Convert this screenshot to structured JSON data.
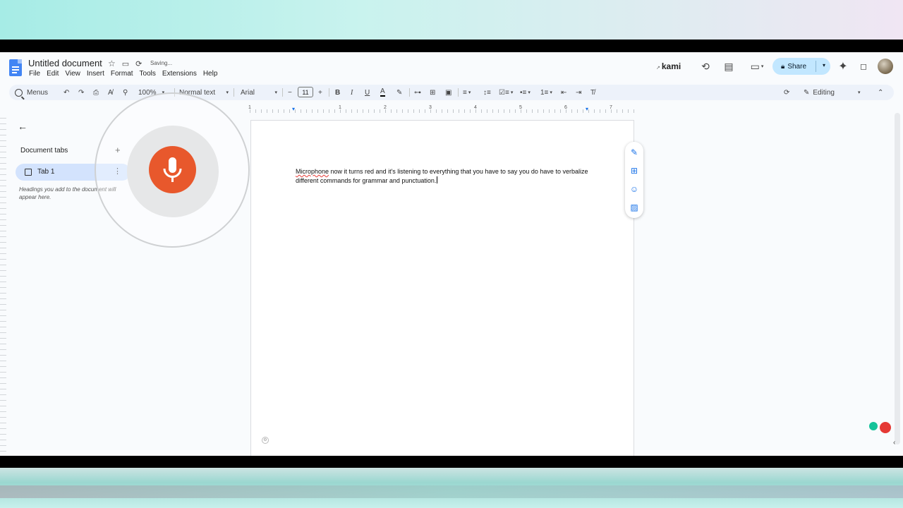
{
  "document": {
    "title": "Untitled document",
    "status": "Saving..."
  },
  "menu": [
    "File",
    "Edit",
    "View",
    "Insert",
    "Format",
    "Tools",
    "Extensions",
    "Help"
  ],
  "header_right": {
    "kami_label": "kami",
    "share_label": "Share"
  },
  "toolbar": {
    "search_label": "Menus",
    "zoom": "100%",
    "style": "Normal text",
    "font": "Arial",
    "font_size": "11",
    "mode": "Editing"
  },
  "sidebar": {
    "title": "Document tabs",
    "tabs": [
      {
        "label": "Tab 1"
      }
    ],
    "hint": "Headings you add to the document will appear here."
  },
  "ruler": {
    "marks": [
      "1",
      "1",
      "2",
      "3",
      "4",
      "5",
      "6",
      "7"
    ]
  },
  "page": {
    "text_first_word": "Microphone",
    "text_rest": " now it turns red and it's listening to everything that you have to say you do have to verbalize different commands for grammar and punctuation."
  },
  "colors": {
    "mic_active": "#e8582c",
    "share_bg": "#c2e7ff",
    "tab_selected": "#d3e3fd",
    "doc_logo": "#4285f4"
  },
  "icons": {
    "float_bar": [
      "edit-suggest-icon",
      "add-comment-icon",
      "emoji-reaction-icon",
      "image-suggest-icon"
    ]
  }
}
